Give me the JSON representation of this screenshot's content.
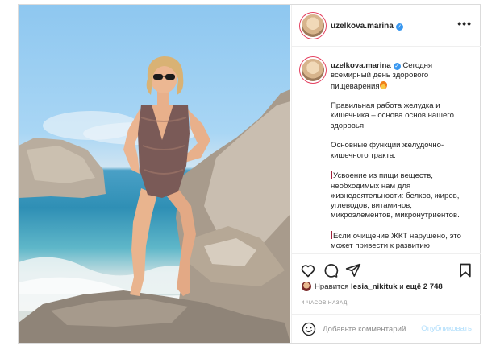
{
  "post": {
    "username": "uzelkova.marina",
    "verified": true,
    "more_icon": "ellipsis-icon",
    "caption": {
      "username": "uzelkova.marina",
      "first_line": "Сегодня всемирный день здорового пищеварения",
      "paragraph_2": "Правильная работа желудка и кишечника – основа основ нашего здоровья.",
      "paragraph_3": "Основные функции желудочно-кишечного тракта:",
      "paragraph_4": "Усвоение из пищи веществ, необходимых нам для жизнедеятельности: белков, жиров, углеводов, витаминов, микроэлементов, микронутриентов.",
      "paragraph_5": "Если очищение ЖКТ нарушено, это может привести к развитию"
    },
    "actions": {
      "like_icon": "heart-icon",
      "comment_icon": "comment-icon",
      "share_icon": "paper-plane-icon",
      "save_icon": "bookmark-icon"
    },
    "likes": {
      "prefix": "Нравится",
      "user": "lesia_nikituk",
      "middle": "и",
      "rest": "ещё 2 748"
    },
    "timestamp": "4 часов назад",
    "comment": {
      "emoji_icon": "smiley-icon",
      "placeholder": "Добавьте комментарий...",
      "publish_label": "Опубликовать"
    }
  },
  "colors": {
    "verified_blue": "#3897f0",
    "publish_disabled": "#b2dffc",
    "border": "#dbdbdb",
    "muted_text": "#8e8e8e"
  }
}
